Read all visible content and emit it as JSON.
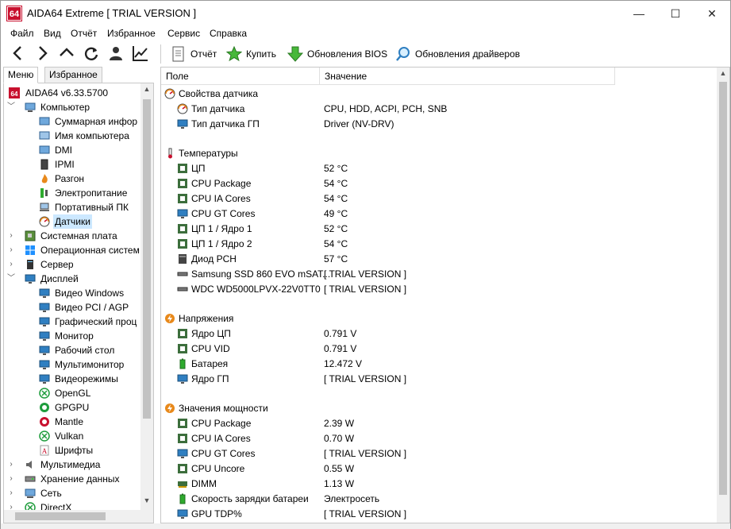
{
  "window": {
    "title": "AIDA64 Extreme  [ TRIAL VERSION ]",
    "logo_text": "64",
    "minimize": "—",
    "maximize": "☐",
    "close": "✕"
  },
  "menu": [
    "Файл",
    "Вид",
    "Отчёт",
    "Избранное",
    "Сервис",
    "Справка"
  ],
  "toolbar": {
    "report": "Отчёт",
    "buy": "Купить",
    "bios_updates": "Обновления BIOS",
    "driver_updates": "Обновления драйверов"
  },
  "tabs": {
    "menu": "Меню",
    "favorites": "Избранное"
  },
  "tree": [
    {
      "label": "AIDA64 v6.33.5700",
      "icon": "aida-icon",
      "level": 0,
      "expander": ""
    },
    {
      "label": "Компьютер",
      "icon": "computer-icon",
      "level": 0,
      "expander": "open"
    },
    {
      "label": "Суммарная инфор",
      "icon": "summary-icon",
      "level": 1,
      "expander": ""
    },
    {
      "label": "Имя компьютера",
      "icon": "computer-name-icon",
      "level": 1,
      "expander": ""
    },
    {
      "label": "DMI",
      "icon": "dmi-icon",
      "level": 1,
      "expander": ""
    },
    {
      "label": "IPMI",
      "icon": "ipmi-icon",
      "level": 1,
      "expander": ""
    },
    {
      "label": "Разгон",
      "icon": "overclock-icon",
      "level": 1,
      "expander": ""
    },
    {
      "label": "Электропитание",
      "icon": "power-icon",
      "level": 1,
      "expander": ""
    },
    {
      "label": "Портативный ПК",
      "icon": "laptop-icon",
      "level": 1,
      "expander": ""
    },
    {
      "label": "Датчики",
      "icon": "sensor-icon",
      "level": 1,
      "expander": "",
      "selected": true
    },
    {
      "label": "Системная плата",
      "icon": "motherboard-icon",
      "level": 0,
      "expander": "closed"
    },
    {
      "label": "Операционная систем",
      "icon": "windows-icon",
      "level": 0,
      "expander": "closed"
    },
    {
      "label": "Сервер",
      "icon": "server-icon",
      "level": 0,
      "expander": "closed"
    },
    {
      "label": "Дисплей",
      "icon": "display-icon",
      "level": 0,
      "expander": "open"
    },
    {
      "label": "Видео Windows",
      "icon": "monitor-icon",
      "level": 1,
      "expander": ""
    },
    {
      "label": "Видео PCI / AGP",
      "icon": "monitor-icon",
      "level": 1,
      "expander": ""
    },
    {
      "label": "Графический проц",
      "icon": "monitor-icon",
      "level": 1,
      "expander": ""
    },
    {
      "label": "Монитор",
      "icon": "monitor-icon",
      "level": 1,
      "expander": ""
    },
    {
      "label": "Рабочий стол",
      "icon": "monitor-icon",
      "level": 1,
      "expander": ""
    },
    {
      "label": "Мультимонитор",
      "icon": "monitor-icon",
      "level": 1,
      "expander": ""
    },
    {
      "label": "Видеорежимы",
      "icon": "monitor-icon",
      "level": 1,
      "expander": ""
    },
    {
      "label": "OpenGL",
      "icon": "xbox-icon",
      "level": 1,
      "expander": ""
    },
    {
      "label": "GPGPU",
      "icon": "gpgpu-icon",
      "level": 1,
      "expander": ""
    },
    {
      "label": "Mantle",
      "icon": "mantle-icon",
      "level": 1,
      "expander": ""
    },
    {
      "label": "Vulkan",
      "icon": "xbox-icon",
      "level": 1,
      "expander": ""
    },
    {
      "label": "Шрифты",
      "icon": "font-icon",
      "level": 1,
      "expander": ""
    },
    {
      "label": "Мультимедиа",
      "icon": "speaker-icon",
      "level": 0,
      "expander": "closed"
    },
    {
      "label": "Хранение данных",
      "icon": "storage-icon",
      "level": 0,
      "expander": "closed"
    },
    {
      "label": "Сеть",
      "icon": "network-icon",
      "level": 0,
      "expander": "closed"
    },
    {
      "label": "DirectX",
      "icon": "xbox-icon",
      "level": 0,
      "expander": "closed"
    }
  ],
  "columns": {
    "field": "Поле",
    "value": "Значение"
  },
  "rows": [
    {
      "kind": "group",
      "field": "Свойства датчика",
      "value": "",
      "icon": "sensor-icon"
    },
    {
      "kind": "item",
      "field": "Тип датчика",
      "value": "CPU, HDD, ACPI, PCH, SNB",
      "icon": "sensor-icon"
    },
    {
      "kind": "item",
      "field": "Тип датчика ГП",
      "value": "Driver  (NV-DRV)",
      "icon": "monitor-icon"
    },
    {
      "kind": "gap"
    },
    {
      "kind": "group",
      "field": "Температуры",
      "value": "",
      "icon": "thermometer-icon"
    },
    {
      "kind": "item",
      "field": "ЦП",
      "value": "52 °C",
      "icon": "chip-icon"
    },
    {
      "kind": "item",
      "field": "CPU Package",
      "value": "54 °C",
      "icon": "chip-icon"
    },
    {
      "kind": "item",
      "field": "CPU IA Cores",
      "value": "54 °C",
      "icon": "chip-icon"
    },
    {
      "kind": "item",
      "field": "CPU GT Cores",
      "value": "49 °C",
      "icon": "monitor-icon"
    },
    {
      "kind": "item",
      "field": "ЦП 1 / Ядро 1",
      "value": "52 °C",
      "icon": "chip-icon"
    },
    {
      "kind": "item",
      "field": "ЦП 1 / Ядро 2",
      "value": "54 °C",
      "icon": "chip-icon"
    },
    {
      "kind": "item",
      "field": "Диод PCH",
      "value": "57 °C",
      "icon": "pch-icon"
    },
    {
      "kind": "item",
      "field": "Samsung SSD 860 EVO mSAT...",
      "value": "[ TRIAL VERSION ]",
      "icon": "drive-icon"
    },
    {
      "kind": "item",
      "field": "WDC WD5000LPVX-22V0TT0",
      "value": "[ TRIAL VERSION ]",
      "icon": "drive-icon"
    },
    {
      "kind": "gap"
    },
    {
      "kind": "group",
      "field": "Напряжения",
      "value": "",
      "icon": "lightning-icon"
    },
    {
      "kind": "item",
      "field": "Ядро ЦП",
      "value": "0.791 V",
      "icon": "chip-icon"
    },
    {
      "kind": "item",
      "field": "CPU VID",
      "value": "0.791 V",
      "icon": "chip-icon"
    },
    {
      "kind": "item",
      "field": "Батарея",
      "value": "12.472 V",
      "icon": "battery-icon"
    },
    {
      "kind": "item",
      "field": "Ядро ГП",
      "value": "[ TRIAL VERSION ]",
      "icon": "monitor-icon"
    },
    {
      "kind": "gap"
    },
    {
      "kind": "group",
      "field": "Значения мощности",
      "value": "",
      "icon": "lightning-icon"
    },
    {
      "kind": "item",
      "field": "CPU Package",
      "value": "2.39 W",
      "icon": "chip-icon"
    },
    {
      "kind": "item",
      "field": "CPU IA Cores",
      "value": "0.70 W",
      "icon": "chip-icon"
    },
    {
      "kind": "item",
      "field": "CPU GT Cores",
      "value": "[ TRIAL VERSION ]",
      "icon": "monitor-icon"
    },
    {
      "kind": "item",
      "field": "CPU Uncore",
      "value": "0.55 W",
      "icon": "chip-icon"
    },
    {
      "kind": "item",
      "field": "DIMM",
      "value": "1.13 W",
      "icon": "memory-icon"
    },
    {
      "kind": "item",
      "field": "Скорость зарядки батареи",
      "value": "Электросеть",
      "icon": "battery-icon"
    },
    {
      "kind": "item",
      "field": "GPU TDP%",
      "value": "[ TRIAL VERSION ]",
      "icon": "monitor-icon"
    }
  ],
  "colors": {
    "accent": "#c8102e",
    "selection": "#cce8ff",
    "chip": "#3c6e3c",
    "monitor": "#2f7fc1",
    "battery": "#2eaa2e",
    "flame": "#e8891b"
  }
}
